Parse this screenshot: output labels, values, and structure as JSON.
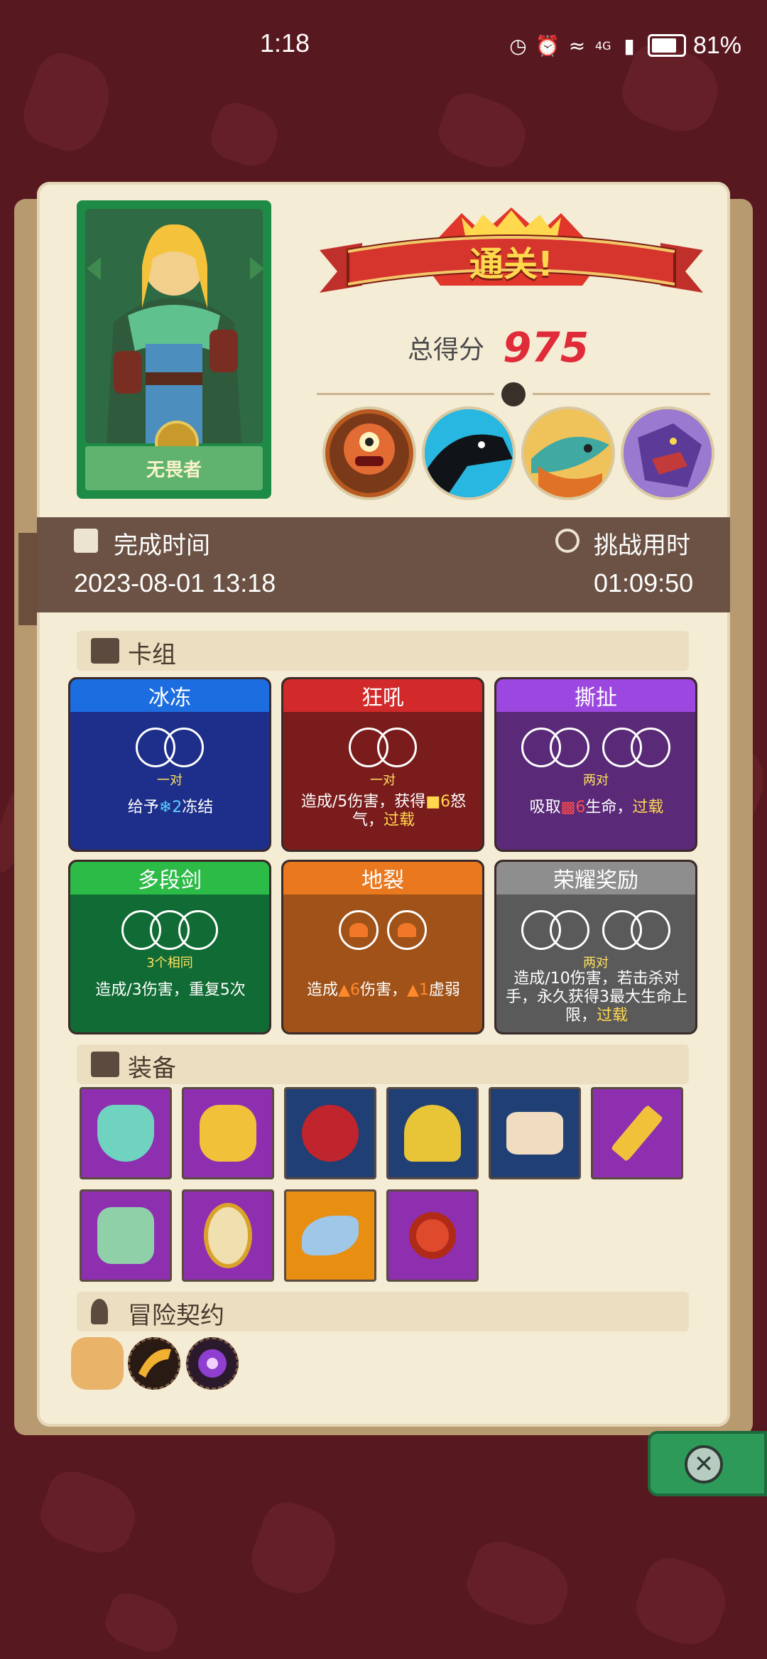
{
  "status_bar": {
    "time": "1:18",
    "network": "4G",
    "battery_pct": "81%",
    "icons": [
      "speed-icon",
      "alarm-icon",
      "wifi-icon",
      "signal-icon",
      "battery-icon"
    ]
  },
  "hero": {
    "name": "无畏者"
  },
  "result": {
    "banner": "通关!",
    "score_label": "总得分",
    "score": "975"
  },
  "times": {
    "finish_label": "完成时间",
    "finish_value": "2023-08-01 13:18",
    "challenge_label": "挑战用时",
    "challenge_value": "01:09:50"
  },
  "deck": {
    "title": "卡组",
    "cards": [
      {
        "name": "冰冻",
        "sub": "一对",
        "desc_pre": "给予",
        "desc_icon": "snowflake-icon",
        "desc_num": "2",
        "desc_post": "冻结",
        "desc_hl": "",
        "head_color": "#1c6de0",
        "body_color": "#1d2f8a"
      },
      {
        "name": "狂吼",
        "sub": "一对",
        "desc_pre": "造成",
        "desc_icon": "sword-icon",
        "desc_num": "5",
        "desc_post": "伤害，获得",
        "desc_num2": "6",
        "desc_post2": "怒气，",
        "desc_hl": "过载",
        "head_color": "#d22a2a",
        "body_color": "#7a1c1c"
      },
      {
        "name": "撕扯",
        "sub": "两对",
        "desc_pre": "吸取",
        "desc_icon": "fang-icon",
        "desc_num": "6",
        "desc_post": "生命，",
        "desc_hl": "过载",
        "head_color": "#9b47e0",
        "body_color": "#5a2a78"
      },
      {
        "name": "多段剑",
        "sub": "3个相同",
        "desc_pre": "造成",
        "desc_icon": "sword-icon",
        "desc_num": "3",
        "desc_post": "伤害，重复5次",
        "desc_hl": "",
        "head_color": "#2dbb48",
        "body_color": "#106b34"
      },
      {
        "name": "地裂",
        "sub": "",
        "desc_pre": "造成",
        "desc_icon": "fire-icon",
        "desc_num": "6",
        "desc_post": "伤害，",
        "desc_num2": "1",
        "desc_post2": "虚弱",
        "desc_hl": "",
        "head_color": "#e9781f",
        "body_color": "#a05218"
      },
      {
        "name": "荣耀奖励",
        "sub": "两对",
        "desc_pre": "造成",
        "desc_icon": "sword-icon",
        "desc_num": "10",
        "desc_post": "伤害，若击杀对手，永久获得3最大生命上限，",
        "desc_hl": "过载",
        "head_color": "#8e8e8e",
        "body_color": "#5a5a5a"
      }
    ]
  },
  "equipment": {
    "title": "装备",
    "items": [
      {
        "name": "lion-shield-icon",
        "bg": "#8e2fb0",
        "fg": "#6fd3c0"
      },
      {
        "name": "heart-pendant-icon",
        "bg": "#8e2fb0",
        "fg": "#f2c13a"
      },
      {
        "name": "demon-heart-icon",
        "bg": "#1f3f75",
        "fg": "#c0242c"
      },
      {
        "name": "gold-helmet-icon",
        "bg": "#1f3f75",
        "fg": "#e8c536"
      },
      {
        "name": "scroll-icon",
        "bg": "#1f3f75",
        "fg": "#f0dcc0"
      },
      {
        "name": "dagger-icon",
        "bg": "#8e2fb0",
        "fg": "#f2c13a"
      },
      {
        "name": "crystal-mask-icon",
        "bg": "#8e2fb0",
        "fg": "#8fd0a8"
      },
      {
        "name": "mirror-icon",
        "bg": "#8e2fb0",
        "fg": "#f0e0b0"
      },
      {
        "name": "horn-icon",
        "bg": "#e88f12",
        "fg": "#9ec7e8"
      },
      {
        "name": "bracelet-icon",
        "bg": "#8e2fb0",
        "fg": "#e04a2c"
      }
    ]
  },
  "contract": {
    "title": "冒险契约",
    "items": [
      "scroll-icon",
      "horn-icon",
      "dark-eye-icon"
    ]
  }
}
